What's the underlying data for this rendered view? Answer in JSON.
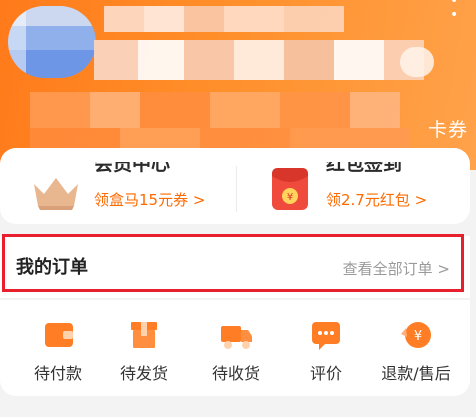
{
  "header": {
    "right_label": "卡券",
    "corner_icon": "more-dots-icon",
    "colors": {
      "accent": "#ff7a1a"
    }
  },
  "member_card": {
    "left": {
      "title": "会员中心",
      "subtitle": "领盒马15元券 >",
      "icon": "crown-icon"
    },
    "right": {
      "title": "红包签到",
      "subtitle": "领2.7元红包 >",
      "icon": "red-envelope-icon"
    }
  },
  "orders": {
    "title": "我的订单",
    "view_all": "查看全部订单 >",
    "highlight_color": "#e8202e"
  },
  "statuses": [
    {
      "label": "待付款",
      "icon": "wallet-icon"
    },
    {
      "label": "待发货",
      "icon": "package-icon"
    },
    {
      "label": "待收货",
      "icon": "truck-icon"
    },
    {
      "label": "评价",
      "icon": "chat-icon"
    },
    {
      "label": "退款/售后",
      "icon": "refund-icon"
    }
  ]
}
